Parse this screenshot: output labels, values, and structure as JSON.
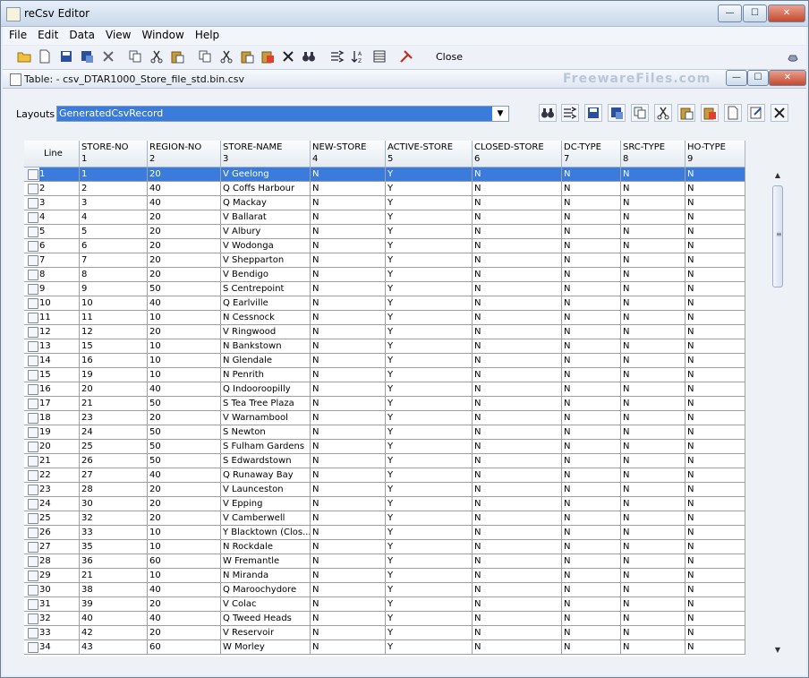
{
  "window": {
    "title": "reCsv Editor",
    "min_label": "—",
    "max_label": "☐",
    "close_label": "✕"
  },
  "menu": [
    "File",
    "Edit",
    "Data",
    "View",
    "Window",
    "Help"
  ],
  "toolbar": {
    "close_label": "Close"
  },
  "internal": {
    "title": "Table:  - csv_DTAR1000_Store_file_std.bin.csv",
    "watermark": "FreewareFiles.com"
  },
  "layouts": {
    "label": "Layouts",
    "value": "GeneratedCsvRecord"
  },
  "columns": [
    {
      "name": "Line",
      "num": ""
    },
    {
      "name": "STORE-NO",
      "num": "1"
    },
    {
      "name": "REGION-NO",
      "num": "2"
    },
    {
      "name": "STORE-NAME",
      "num": "3"
    },
    {
      "name": "NEW-STORE",
      "num": "4"
    },
    {
      "name": "ACTIVE-STORE",
      "num": "5"
    },
    {
      "name": "CLOSED-STORE",
      "num": "6"
    },
    {
      "name": "DC-TYPE",
      "num": "7"
    },
    {
      "name": "SRC-TYPE",
      "num": "8"
    },
    {
      "name": "HO-TYPE",
      "num": "9"
    }
  ],
  "rows": [
    [
      "1",
      "1",
      "20",
      "V Geelong",
      "N",
      "Y",
      "N",
      "N",
      "N",
      "N"
    ],
    [
      "2",
      "2",
      "40",
      "Q Coffs Harbour",
      "N",
      "Y",
      "N",
      "N",
      "N",
      "N"
    ],
    [
      "3",
      "3",
      "40",
      "Q Mackay",
      "N",
      "Y",
      "N",
      "N",
      "N",
      "N"
    ],
    [
      "4",
      "4",
      "20",
      "V Ballarat",
      "N",
      "Y",
      "N",
      "N",
      "N",
      "N"
    ],
    [
      "5",
      "5",
      "20",
      "V Albury",
      "N",
      "Y",
      "N",
      "N",
      "N",
      "N"
    ],
    [
      "6",
      "6",
      "20",
      "V Wodonga",
      "N",
      "Y",
      "N",
      "N",
      "N",
      "N"
    ],
    [
      "7",
      "7",
      "20",
      "V Shepparton",
      "N",
      "Y",
      "N",
      "N",
      "N",
      "N"
    ],
    [
      "8",
      "8",
      "20",
      "V Bendigo",
      "N",
      "Y",
      "N",
      "N",
      "N",
      "N"
    ],
    [
      "9",
      "9",
      "50",
      "S Centrepoint",
      "N",
      "Y",
      "N",
      "N",
      "N",
      "N"
    ],
    [
      "10",
      "10",
      "40",
      "Q Earlville",
      "N",
      "Y",
      "N",
      "N",
      "N",
      "N"
    ],
    [
      "11",
      "11",
      "10",
      "N Cessnock",
      "N",
      "Y",
      "N",
      "N",
      "N",
      "N"
    ],
    [
      "12",
      "12",
      "20",
      "V Ringwood",
      "N",
      "Y",
      "N",
      "N",
      "N",
      "N"
    ],
    [
      "13",
      "15",
      "10",
      "N Bankstown",
      "N",
      "Y",
      "N",
      "N",
      "N",
      "N"
    ],
    [
      "14",
      "16",
      "10",
      "N Glendale",
      "N",
      "Y",
      "N",
      "N",
      "N",
      "N"
    ],
    [
      "15",
      "19",
      "10",
      "N Penrith",
      "N",
      "Y",
      "N",
      "N",
      "N",
      "N"
    ],
    [
      "16",
      "20",
      "40",
      "Q Indooroopilly",
      "N",
      "Y",
      "N",
      "N",
      "N",
      "N"
    ],
    [
      "17",
      "21",
      "50",
      "S Tea Tree Plaza",
      "N",
      "Y",
      "N",
      "N",
      "N",
      "N"
    ],
    [
      "18",
      "23",
      "20",
      "V Warnambool",
      "N",
      "Y",
      "N",
      "N",
      "N",
      "N"
    ],
    [
      "19",
      "24",
      "50",
      "S Newton",
      "N",
      "Y",
      "N",
      "N",
      "N",
      "N"
    ],
    [
      "20",
      "25",
      "50",
      "S Fulham Gardens",
      "N",
      "Y",
      "N",
      "N",
      "N",
      "N"
    ],
    [
      "21",
      "26",
      "50",
      "S Edwardstown",
      "N",
      "Y",
      "N",
      "N",
      "N",
      "N"
    ],
    [
      "22",
      "27",
      "40",
      "Q Runaway Bay",
      "N",
      "Y",
      "N",
      "N",
      "N",
      "N"
    ],
    [
      "23",
      "28",
      "20",
      "V Launceston",
      "N",
      "Y",
      "N",
      "N",
      "N",
      "N"
    ],
    [
      "24",
      "30",
      "20",
      "V Epping",
      "N",
      "Y",
      "N",
      "N",
      "N",
      "N"
    ],
    [
      "25",
      "32",
      "20",
      "V Camberwell",
      "N",
      "Y",
      "N",
      "N",
      "N",
      "N"
    ],
    [
      "26",
      "33",
      "10",
      "Y Blacktown (Clos...",
      "N",
      "Y",
      "N",
      "N",
      "N",
      "N"
    ],
    [
      "27",
      "35",
      "10",
      "N Rockdale",
      "N",
      "Y",
      "N",
      "N",
      "N",
      "N"
    ],
    [
      "28",
      "36",
      "60",
      "W Fremantle",
      "N",
      "Y",
      "N",
      "N",
      "N",
      "N"
    ],
    [
      "29",
      "21",
      "10",
      "N Miranda",
      "N",
      "Y",
      "N",
      "N",
      "N",
      "N"
    ],
    [
      "30",
      "38",
      "40",
      "Q Maroochydore",
      "N",
      "Y",
      "N",
      "N",
      "N",
      "N"
    ],
    [
      "31",
      "39",
      "20",
      "V Colac",
      "N",
      "Y",
      "N",
      "N",
      "N",
      "N"
    ],
    [
      "32",
      "40",
      "40",
      "Q Tweed Heads",
      "N",
      "Y",
      "N",
      "N",
      "N",
      "N"
    ],
    [
      "33",
      "42",
      "20",
      "V Reservoir",
      "N",
      "Y",
      "N",
      "N",
      "N",
      "N"
    ],
    [
      "34",
      "43",
      "60",
      "W Morley",
      "N",
      "Y",
      "N",
      "N",
      "N",
      "N"
    ]
  ],
  "colors": {
    "selection": "#3a7bdc",
    "accent": "#2f6fd0"
  }
}
